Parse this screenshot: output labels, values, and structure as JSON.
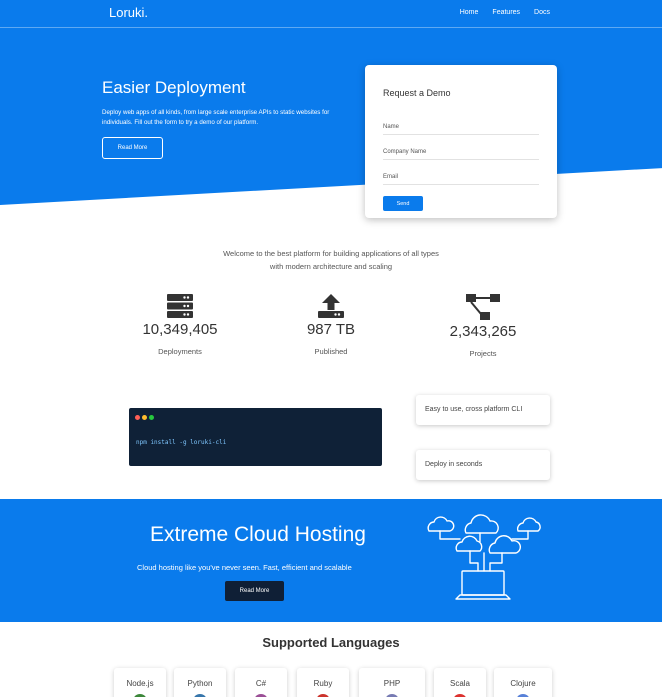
{
  "navbar": {
    "logo": "Loruki.",
    "links": [
      "Home",
      "Features",
      "Docs"
    ]
  },
  "hero": {
    "title": "Easier Deployment",
    "text": "Deploy web apps of all kinds, from large scale enterprise APIs to static websites for individuals. Fill out the form to try a demo of our platform.",
    "button": "Read More"
  },
  "demo_form": {
    "title": "Request a Demo",
    "fields": [
      "Name",
      "Company Name",
      "Email"
    ],
    "submit": "Send"
  },
  "stats": {
    "intro": "Welcome to the best platform for building applications of all types with modern architecture and scaling",
    "items": [
      {
        "value": "10,349,405",
        "label": "Deployments",
        "icon": "server-icon"
      },
      {
        "value": "987 TB",
        "label": "Published",
        "icon": "upload-icon"
      },
      {
        "value": "2,343,265",
        "label": "Projects",
        "icon": "project-diagram-icon"
      }
    ]
  },
  "cli": {
    "command": "npm install -g loruki-cli",
    "features": [
      "Easy to use, cross platform CLI",
      "Deploy in seconds"
    ]
  },
  "cloud": {
    "title": "Extreme Cloud Hosting",
    "text": "Cloud hosting like you've never seen. Fast, efficient and scalable",
    "button": "Read More"
  },
  "languages": {
    "title": "Supported Languages",
    "items": [
      "Node.js",
      "Python",
      "C#",
      "Ruby",
      "PHP",
      "Scala",
      "Clojure"
    ]
  },
  "colors": {
    "primary": "#0a7bec",
    "dark": "#0f1f36",
    "terminal_red": "#ff5f56",
    "terminal_yellow": "#ffbd2e",
    "terminal_green": "#27c93f"
  }
}
